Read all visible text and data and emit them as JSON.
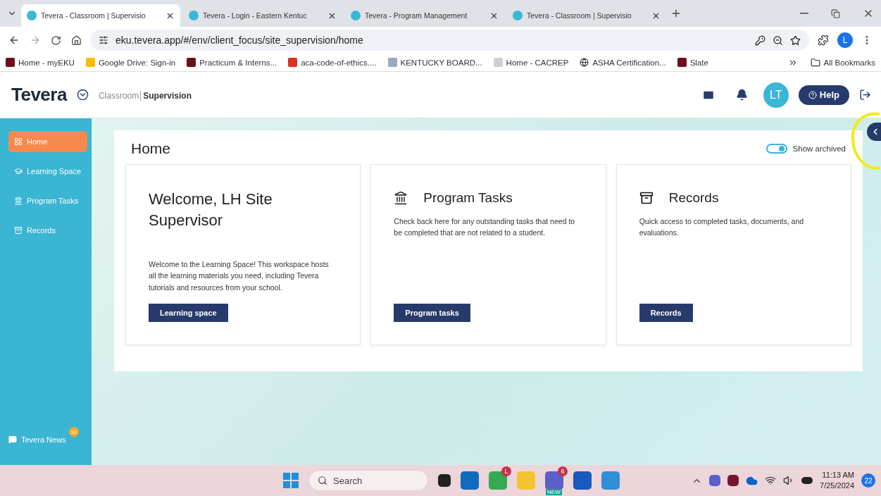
{
  "browser": {
    "tabs": [
      {
        "title": "Tevera - Classroom | Supervisio",
        "selected": true
      },
      {
        "title": "Tevera - Login - Eastern Kentuc",
        "selected": false
      },
      {
        "title": "Tevera - Program Management",
        "selected": false
      },
      {
        "title": "Tevera - Classroom | Supervisio",
        "selected": false
      }
    ],
    "address": "eku.tevera.app/#/env/client_focus/site_supervision/home",
    "profile_initial": "L",
    "bookmarks": [
      {
        "label": "Home - myEKU",
        "kind": "eku"
      },
      {
        "label": "Google Drive: Sign-in",
        "kind": "drive"
      },
      {
        "label": "Practicum & Interns...",
        "kind": "eku"
      },
      {
        "label": "aca-code-of-ethics....",
        "kind": "pdf"
      },
      {
        "label": "KENTUCKY BOARD...",
        "kind": "doc"
      },
      {
        "label": "Home - CACREP",
        "kind": "blank"
      },
      {
        "label": "ASHA Certification...",
        "kind": "globe"
      },
      {
        "label": "Slate",
        "kind": "eku"
      }
    ],
    "all_bookmarks": "All Bookmarks"
  },
  "app": {
    "logo": "Tevera",
    "breadcrumb": {
      "section": "Classroom",
      "current": "Supervision"
    },
    "avatar": "LT",
    "help": "Help",
    "sidebar": {
      "items": [
        {
          "label": "Home",
          "kind": "home",
          "selected": true
        },
        {
          "label": "Learning Space",
          "kind": "learning",
          "selected": false
        },
        {
          "label": "Program Tasks",
          "kind": "tasks",
          "selected": false
        },
        {
          "label": "Records",
          "kind": "records",
          "selected": false
        }
      ],
      "news": {
        "label": "Tevera News",
        "badge": "10"
      }
    },
    "page": {
      "title": "Home",
      "archived_toggle": {
        "label": "Show archived",
        "on": true
      },
      "cards": [
        {
          "kind": "welcome",
          "title": "Welcome, LH Site Supervisor",
          "text": "Welcome to the Learning Space! This workspace hosts all the learning materials you need, including Tevera tutorials and resources from your school.",
          "button": "Learning space"
        },
        {
          "kind": "tasks",
          "title": "Program Tasks",
          "text": "Check back here for any outstanding tasks that need to be completed that are not related to a student.",
          "button": "Program tasks"
        },
        {
          "kind": "records",
          "title": "Records",
          "text": "Quick access to completed tasks, documents, and evaluations.",
          "button": "Records"
        }
      ]
    }
  },
  "taskbar": {
    "search": "Search",
    "apps": [
      {
        "kind": "outlook"
      },
      {
        "kind": "chrome",
        "badge": "L"
      },
      {
        "kind": "files"
      },
      {
        "kind": "teams",
        "badge": "6",
        "tag": "NEW"
      },
      {
        "kind": "word"
      },
      {
        "kind": "photos"
      }
    ],
    "time": "11:13 AM",
    "date": "7/25/2024",
    "notifications": "22"
  }
}
